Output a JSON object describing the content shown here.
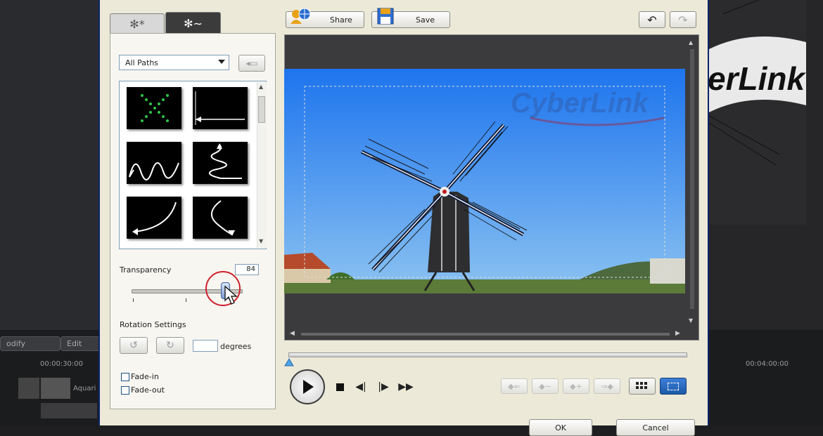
{
  "background_app": {
    "modify_label": "odify",
    "edit_label": "Edit",
    "time_left": "00:00:30:00",
    "time_right": "00:04:00:00",
    "clip_label": "Aquari",
    "preview_brand": "erLink"
  },
  "tabs": [
    {
      "label": "✻*"
    },
    {
      "label": "✻∼"
    }
  ],
  "left": {
    "category_select": "All Paths",
    "transparency_label": "Transparency",
    "transparency_value": "84",
    "rotation_label": "Rotation Settings",
    "rotation_input": "",
    "degrees_label": "degrees",
    "fade_in_label": "Fade-in",
    "fade_out_label": "Fade-out",
    "transparency_level": 0.84
  },
  "toolbar": {
    "share_label": "Share",
    "save_label": "Save"
  },
  "preview": {
    "watermark": "CyberLink"
  },
  "footer": {
    "ok_label": "OK",
    "cancel_label": "Cancel"
  },
  "colors": {
    "sky_top": "#1d74ee",
    "sky_bottom": "#8cc3f1",
    "accent": "#1c5aa8"
  }
}
